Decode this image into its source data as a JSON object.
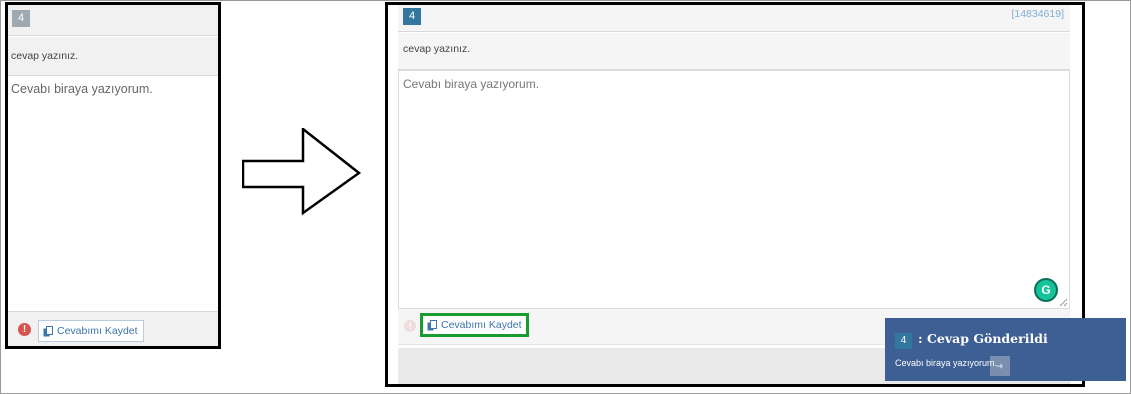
{
  "before": {
    "question_number": "4",
    "question_text": "cevap yazınız.",
    "answer_text": "Cevabı biraya yazıyorum.",
    "save_label": "Cevabımı Kaydet",
    "warning_symbol": "!"
  },
  "after": {
    "question_number": "4",
    "question_id": "[14834619]",
    "question_text": "cevap yazınız.",
    "answer_text": "Cevabı biraya yazıyorum.",
    "save_label": "Cevabımı Kaydet",
    "warning_symbol": "!",
    "grammarly_letter": "G",
    "save_highlight_color": "#1a9b2e"
  },
  "toast": {
    "number": "4",
    "title": ": Cevap Gönderildi",
    "body": "Cevabı biraya yazıyorum.",
    "background_color": "#3e5f93"
  },
  "icons": {
    "save": "copy-icon",
    "warning": "exclamation-circle-icon",
    "arrow": "right-arrow-outline-icon",
    "grammarly": "grammarly-icon"
  },
  "colors": {
    "number_badge_active": "#33779f",
    "number_badge_inactive": "#9fa9b1",
    "link_blue": "#3c75ad",
    "warning_red": "#d9534f"
  }
}
